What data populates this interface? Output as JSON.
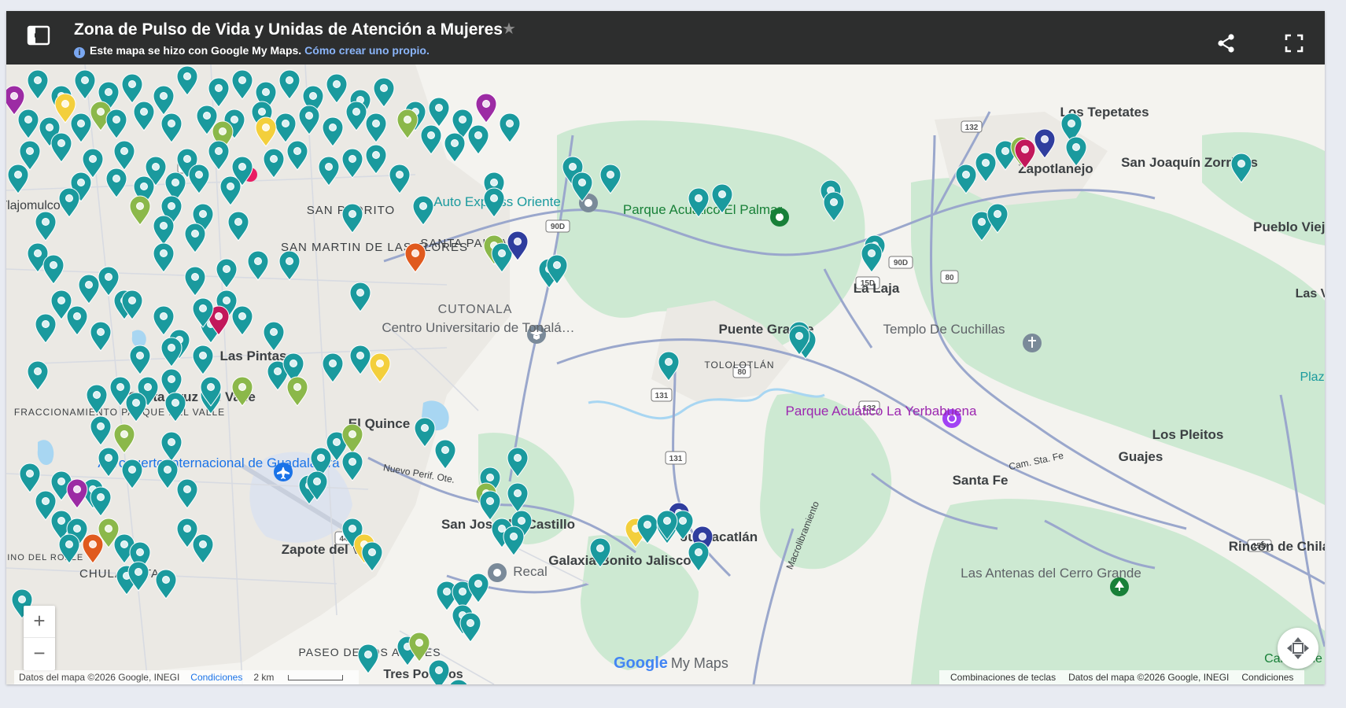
{
  "header": {
    "title": "Zona de Pulso de Vida y Unidas de Atención a Mujeres",
    "subtitle": "Este mapa se hizo con Google My Maps.",
    "create_link": "Cómo crear uno propio."
  },
  "colors": {
    "header_bg": "#2d2e2e",
    "pin_teal": "#1a9a9e",
    "pin_green": "#8bb84a",
    "pin_yellow": "#f3cf3c",
    "pin_purple": "#9c2ba4",
    "pin_navy": "#2f3d9e",
    "pin_orange": "#e05a1e",
    "pin_magenta": "#c2185b",
    "road": "#9aa7cc",
    "park": "#c9e8cf"
  },
  "icons": [
    "layers-icon",
    "star-icon",
    "info-icon",
    "share-icon",
    "fullscreen-icon",
    "recenter-icon",
    "airport-icon",
    "school-icon",
    "church-icon",
    "park-icon",
    "amusement-park-icon"
  ],
  "map": {
    "places": [
      "Los Tepetates",
      "Zapotlanejo",
      "San Joaquín Zorrillos",
      "Pueblo Viejo",
      "SAN PEDRITO",
      "Auto Express Oriente",
      "Parque Acuático El Palmar",
      "SAN MARTIN DE LAS FLORES",
      "SANTA PAULA",
      "La Laja",
      "CUTONALA",
      "Centro Universitario de Tonalá…",
      "Puente Grande",
      "Templo De Cuchillas",
      "TOLOLOTLÁN",
      "Las Pintas",
      "Santa Cruz del Valle",
      "FRACCIONAMIENTO PARQUE DEL VALLE",
      "El Quince",
      "Parque Acuático La Yerbabuena",
      "Los Pleitos",
      "Guajes",
      "Santa Fe",
      "Cam. Sta. Fe",
      "Aeropuerto Internacional de Guadalajara",
      "Nuevo Perif. Ote.",
      "San José del Castillo",
      "Zapote del Valle",
      "Galaxia Bonito Jalisco",
      "Juanacatlán",
      "Macrolibramiento",
      "Rincón de Chila",
      "Las Antenas del Cerro Grande",
      "Recal",
      "CHULAVISTA",
      "CAMINO DEL ROBLE",
      "PASEO DE LOS AGAVES",
      "Tres Potrillos",
      "Campo de",
      "Plaz",
      "Las V",
      "Tlajomulco"
    ],
    "shields": [
      "90D",
      "90D",
      "15D",
      "80",
      "80",
      "131",
      "131",
      "132",
      "44",
      "23",
      "15D",
      "132"
    ]
  },
  "controls": {
    "zoom_in": "+",
    "zoom_out": "−"
  },
  "branding": {
    "google": "Google",
    "my_maps": "My Maps"
  },
  "footer": {
    "map_data": "Datos del mapa ©2026 Google, INEGI",
    "terms": "Condiciones",
    "scale": "2 km",
    "shortcuts": "Combinaciones de teclas",
    "map_data_right": "Datos del mapa ©2026 Google, INEGI",
    "terms_right": "Condiciones"
  }
}
